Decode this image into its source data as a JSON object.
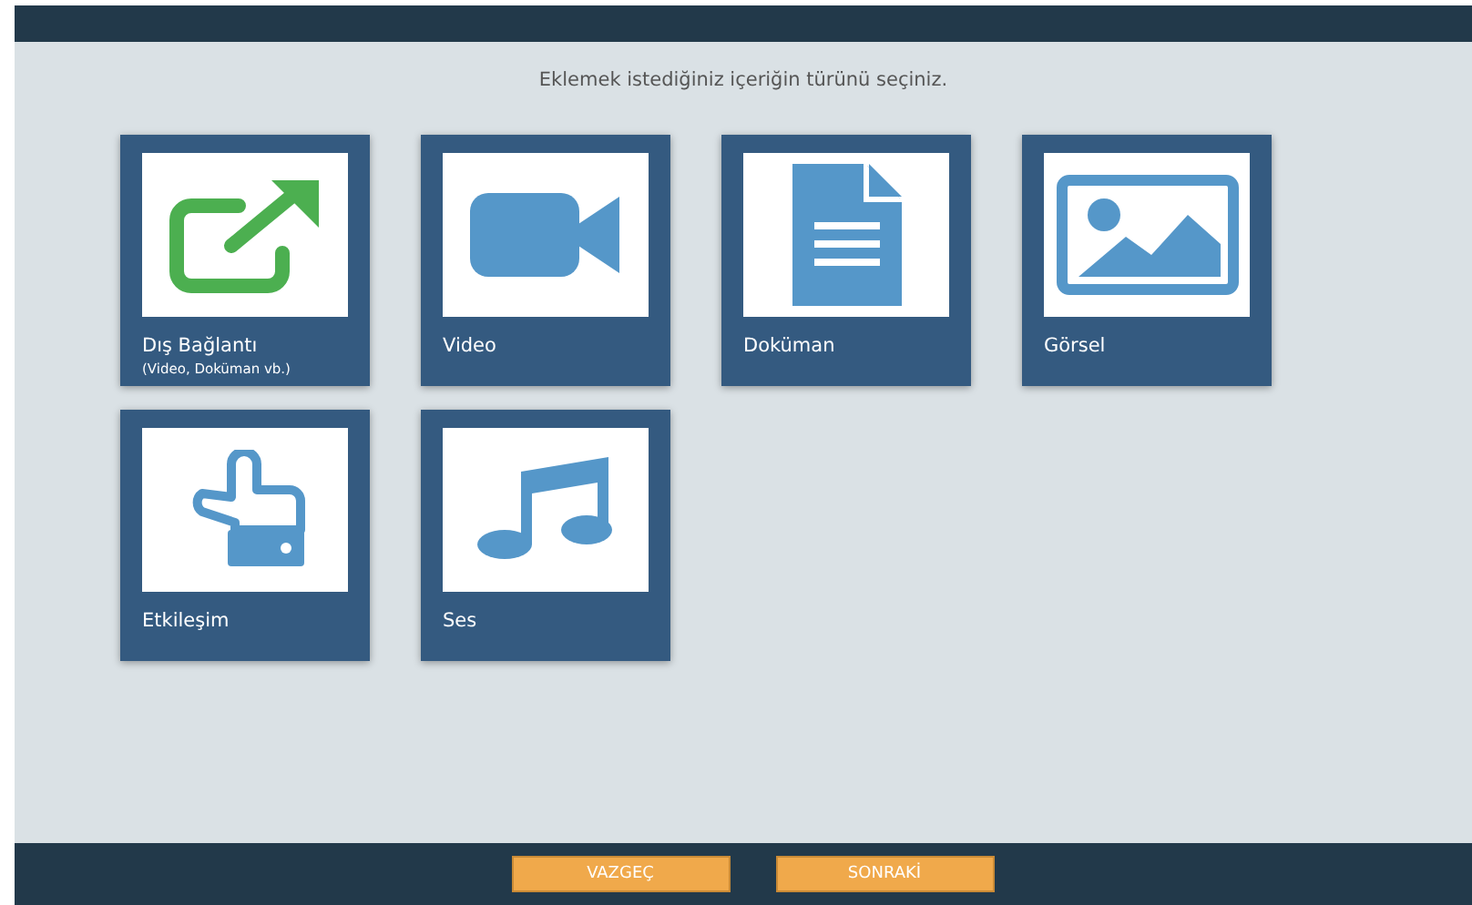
{
  "prompt": "Eklemek istediğiniz içeriğin türünü seçiniz.",
  "content_types": [
    {
      "kind": "link",
      "label": "Dış Bağlantı",
      "sublabel": "(Video, Doküman vb.)"
    },
    {
      "kind": "video",
      "label": "Video"
    },
    {
      "kind": "document",
      "label": "Doküman"
    },
    {
      "kind": "image",
      "label": "Görsel"
    },
    {
      "kind": "interaction",
      "label": "Etkileşim"
    },
    {
      "kind": "audio",
      "label": "Ses"
    }
  ],
  "buttons": [
    "VAZGEÇ",
    "SONRAKİ"
  ]
}
